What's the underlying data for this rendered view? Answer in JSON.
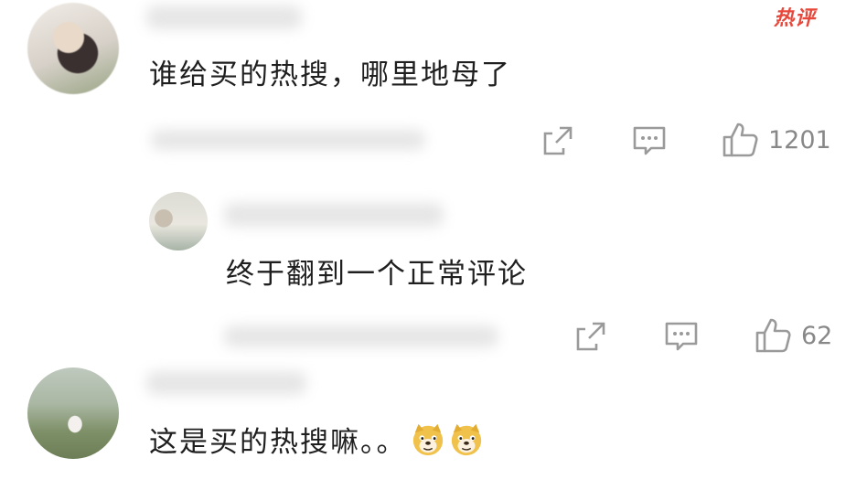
{
  "hot_badge": "热评",
  "comments": [
    {
      "text": "谁给买的热搜，哪里地母了",
      "likes": "1201"
    },
    {
      "text": "终于翻到一个正常评论",
      "likes": "62"
    },
    {
      "text": "这是买的热搜嘛。。",
      "emojis": [
        "doge-emoji",
        "doge-emoji"
      ]
    }
  ],
  "colors": {
    "hot_badge": "#e8483b",
    "text": "#1f1f1f",
    "icon": "#9a9a9a",
    "count": "#888888"
  }
}
